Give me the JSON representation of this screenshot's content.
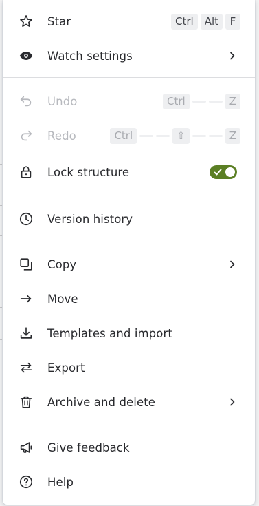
{
  "menu": {
    "items": [
      {
        "label": "Star",
        "icon": "star-icon",
        "shortcut": [
          "Ctrl",
          "Alt",
          "F"
        ]
      },
      {
        "label": "Watch settings",
        "icon": "eye-icon",
        "submenu": true
      },
      {
        "label": "Undo",
        "icon": "undo-icon",
        "disabled": true,
        "shortcut": [
          "Ctrl",
          "Z"
        ]
      },
      {
        "label": "Redo",
        "icon": "redo-icon",
        "disabled": true,
        "shortcut": [
          "Ctrl",
          "⇧",
          "Z"
        ]
      },
      {
        "label": "Lock structure",
        "icon": "lock-icon",
        "toggle": true,
        "toggle_state": "on"
      },
      {
        "label": "Version history",
        "icon": "clock-icon"
      },
      {
        "label": "Copy",
        "icon": "copy-icon",
        "submenu": true
      },
      {
        "label": "Move",
        "icon": "arrow-right-icon"
      },
      {
        "label": "Templates and import",
        "icon": "download-icon"
      },
      {
        "label": "Export",
        "icon": "swap-arrows-icon"
      },
      {
        "label": "Archive and delete",
        "icon": "trash-icon",
        "submenu": true
      },
      {
        "label": "Give feedback",
        "icon": "megaphone-icon"
      },
      {
        "label": "Help",
        "icon": "help-icon"
      }
    ]
  },
  "colors": {
    "toggle_on": "#5b7f24",
    "text": "#292a2e",
    "disabled_text": "#b7b9be",
    "key_bg": "#eeeff1"
  }
}
